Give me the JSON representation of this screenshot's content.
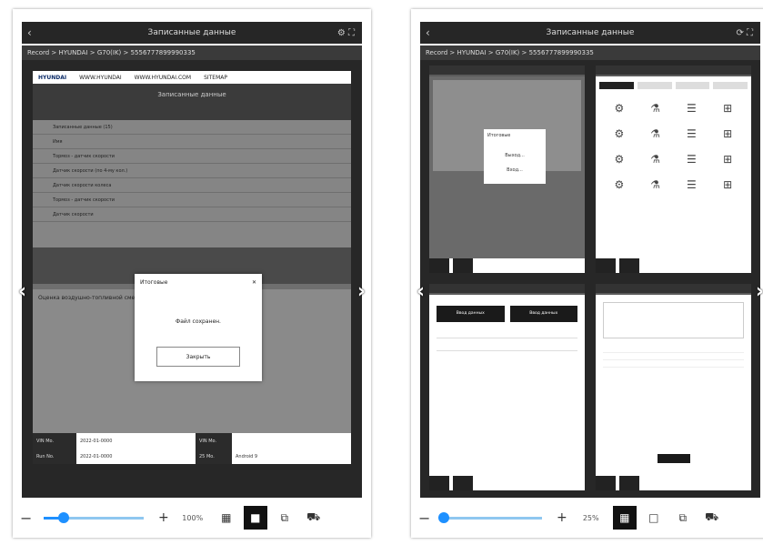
{
  "left": {
    "title": "Записанные данные",
    "breadcrumb": "Record > HYUNDAI > G70(IK) > 5556777899990335",
    "header": {
      "logo": "HYUNDAI",
      "links": [
        "WWW.HYUNDAI",
        "WWW.HYUNDAI.COM",
        "SITEMAP"
      ]
    },
    "toolbar_title": "Записанные данные",
    "table_title": "Записанные данные (15)",
    "table_header": "Имя",
    "rows": [
      "Тормоз - датчик скорости",
      "Датчик скорости (по 4-му кол.)",
      "Датчик скорости колеса",
      "Тормоз - датчик скорости",
      "Датчик скорости"
    ],
    "panel_title": "Оценка воздушно-топливной смеси",
    "dialog": {
      "title": "Итоговые",
      "message": "Файл сохранен.",
      "ok": "Закрыть"
    },
    "footer": {
      "l1": "VIN Mo.",
      "v1": "2022-01-0000",
      "l2": "VIN Mo.",
      "v2": "",
      "l3": "Run No.",
      "v3": "2022-01-0000",
      "l4": "25 Mo.",
      "v4": "Android 9"
    },
    "zoom": "100%"
  },
  "right": {
    "title": "Записанные данные",
    "breadcrumb": "Record > HYUNDAI > G70(IK) > 5556777899990335",
    "dialog_title": "Итоговые",
    "dialog_msg": "Выход...",
    "dialog_ok": "Вход...",
    "btn_a": "Ввод данных",
    "btn_b": "Ввод данных",
    "zoom": "25%"
  },
  "icons": {
    "back": "back-icon",
    "settings": "gear-icon",
    "expand": "expand-icon",
    "grid": "grid-view-icon",
    "single": "single-view-icon",
    "record": "record-icon",
    "car": "car-icon"
  },
  "slider": {
    "left_value": 0.2,
    "right_value": 0.02
  }
}
